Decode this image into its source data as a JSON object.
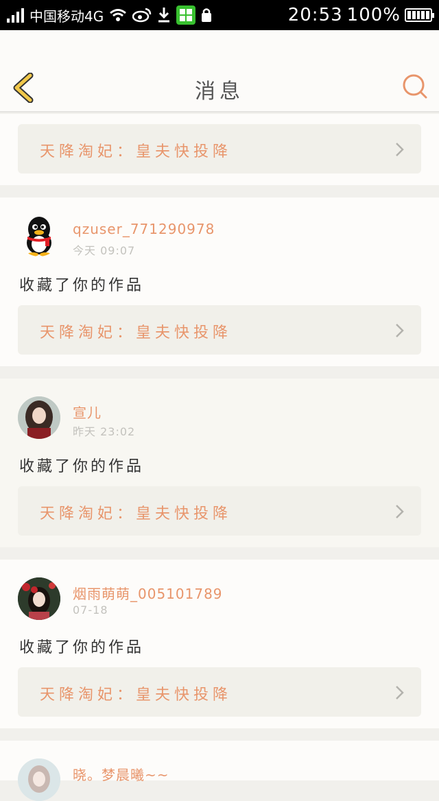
{
  "status_bar": {
    "carrier": "中国移动4G",
    "time": "20:53",
    "battery": "100%"
  },
  "header": {
    "title": "消息",
    "back_icon": "back-chevron-icon",
    "search_icon": "search-icon"
  },
  "colors": {
    "accent": "#e8956b",
    "back_arrow": "#f1c84a",
    "card_bg": "#fdfcfa",
    "link_bg": "#f1f0ea"
  },
  "notifications": [
    {
      "work_title": "天降淘妃：皇夫快投降"
    },
    {
      "username": "qzuser_771290978",
      "time": "今天 09:07",
      "action": "收藏了你的作品",
      "work_title": "天降淘妃：皇夫快投降",
      "avatar": "qq-penguin-avatar"
    },
    {
      "username": "宣儿",
      "time": "昨天 23:02",
      "action": "收藏了你的作品",
      "work_title": "天降淘妃：皇夫快投降",
      "avatar": "girl-photo-avatar"
    },
    {
      "username": "烟雨萌萌_005101789",
      "time": "07-18",
      "action": "收藏了你的作品",
      "work_title": "天降淘妃：皇夫快投降",
      "avatar": "girl-flowers-avatar"
    },
    {
      "username": "晓。梦晨曦~~",
      "avatar": "girl-light-avatar"
    }
  ]
}
